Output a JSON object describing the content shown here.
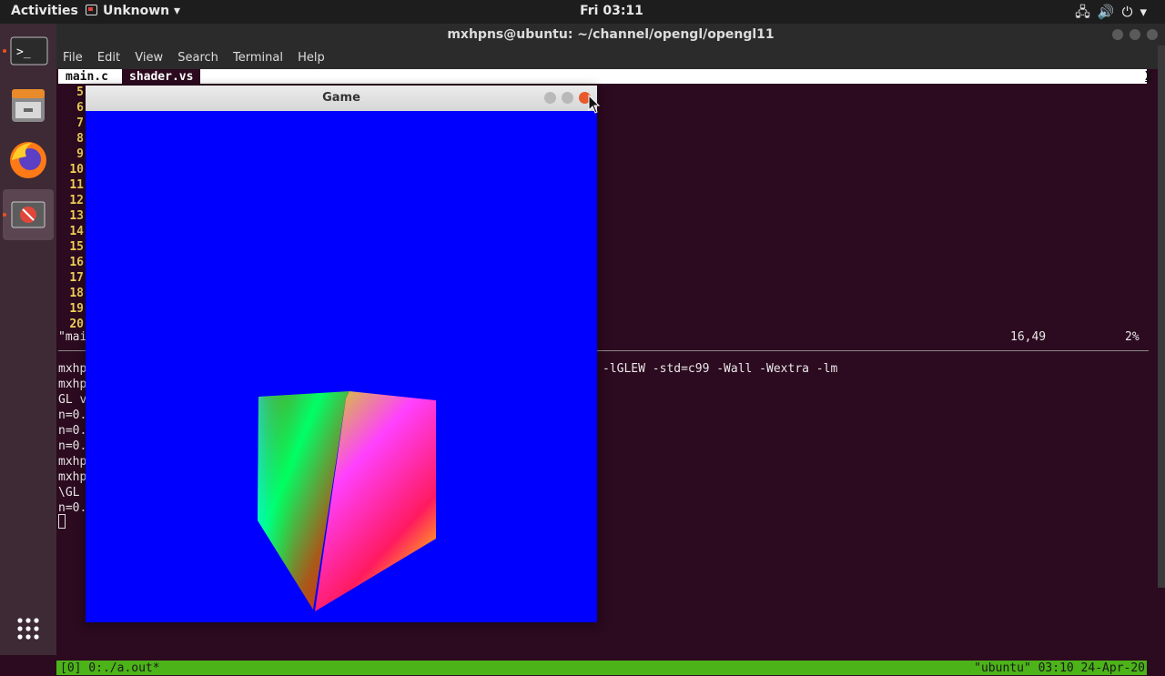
{
  "topbar": {
    "activities": "Activities",
    "app_menu": "Unknown ▾",
    "clock": "Fri 03:11",
    "tray_icons": [
      "network-icon",
      "volume-icon",
      "power-icon",
      "chevron-down-icon"
    ]
  },
  "dock": {
    "items": [
      "terminal-icon",
      "files-icon",
      "firefox-icon",
      "unknown-app-icon",
      "show-applications-icon"
    ]
  },
  "terminal": {
    "title": "mxhpns@ubuntu: ~/channel/opengl/opengl11",
    "menu": [
      "File",
      "Edit",
      "View",
      "Search",
      "Terminal",
      "Help"
    ],
    "tabs": [
      "main.c",
      "shader.vs"
    ],
    "tab_close": "X",
    "line_numbers": [
      "5",
      "6",
      "7",
      "8",
      "9",
      "10",
      "11",
      "12",
      "13",
      "14",
      "15",
      "16",
      "17",
      "18",
      "19",
      "20"
    ],
    "vim_status_left": "\"mai",
    "vim_status_pos": "16,49",
    "vim_status_pct": "2%",
    "shell_lines_left": [
      "mxhp",
      "mxhp",
      "GL v",
      "n=0.",
      "n=0.",
      "n=0.",
      "mxhp",
      "mxhp",
      "\\GL",
      "n=0."
    ],
    "shell_line_tail": "-lGLEW -std=c99 -Wall -Wextra -lm",
    "tmux_left": "[0] 0:./a.out*",
    "tmux_right": "\"ubuntu\" 03:10 24-Apr-20"
  },
  "game": {
    "title": "Game",
    "background": "#0000ff"
  },
  "colors": {
    "terminal_bg": "#2c0a1f",
    "line_number": "#f2d15a",
    "tmux_bar": "#4cb319",
    "close_button": "#e85a2c"
  }
}
